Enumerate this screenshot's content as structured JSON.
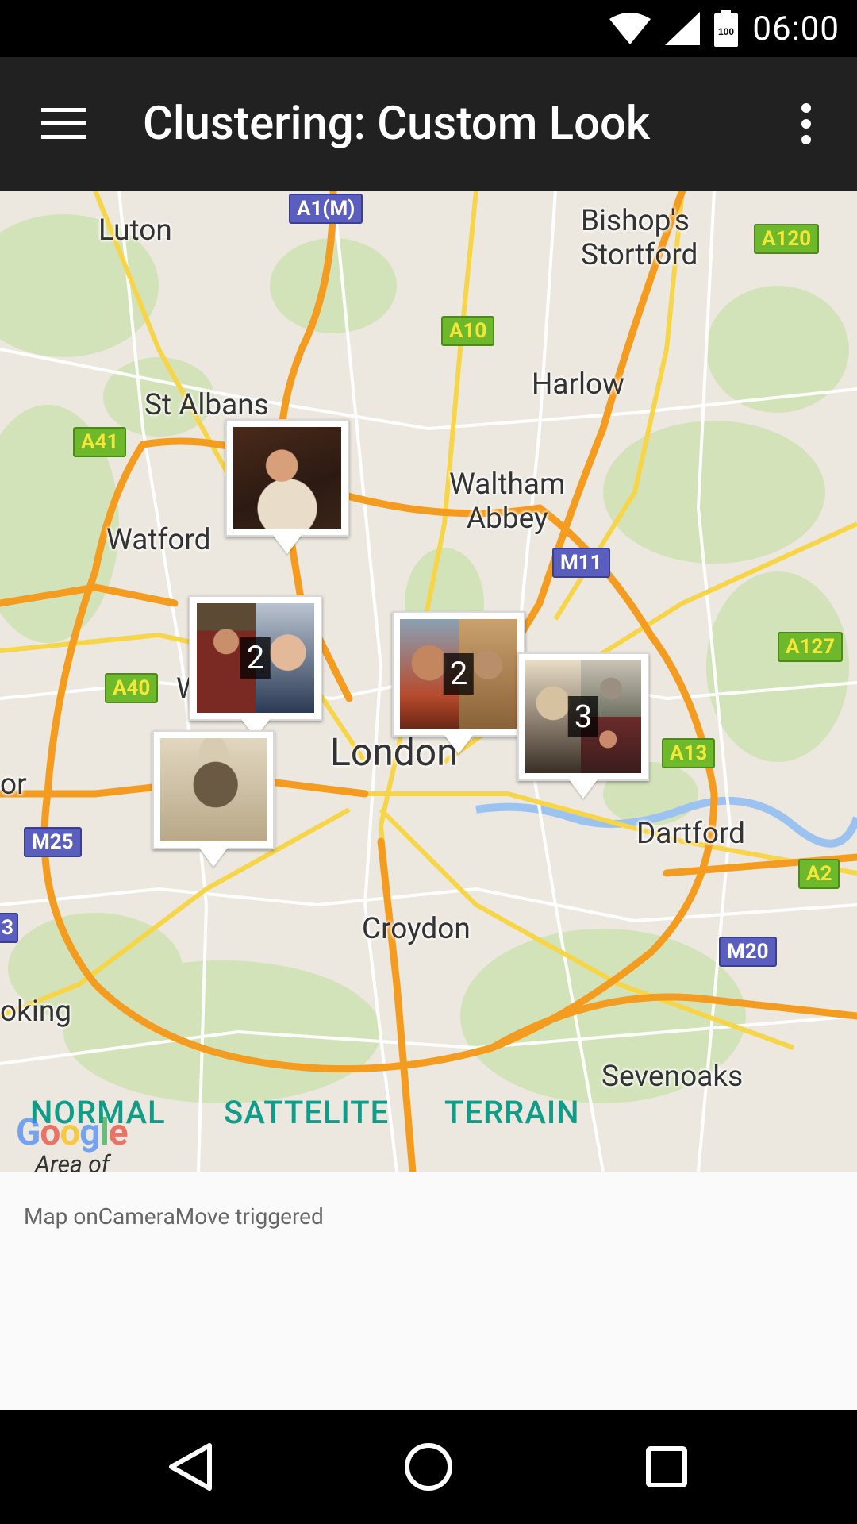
{
  "status_bar": {
    "time": "06:00",
    "battery_level": "100",
    "icons": [
      "wifi-icon",
      "cell-signal-icon",
      "battery-icon"
    ]
  },
  "app_bar": {
    "title": "Clustering: Custom Look",
    "icons": [
      "menu-icon",
      "more-vert-icon"
    ]
  },
  "map": {
    "places": {
      "luton": "Luton",
      "bishops_stortford": "Bishop's\nStortford",
      "harlow": "Harlow",
      "st_albans": "St Albans",
      "waltham_abbey": "Waltham\nAbbey",
      "watford": "Watford",
      "london": "London",
      "dartford": "Dartford",
      "croydon": "Croydon",
      "sevenoaks": "Sevenoaks",
      "woking": "oking",
      "w_partial": "W",
      "or_partial": "or"
    },
    "road_shields": {
      "a1m": "A1(M)",
      "a120": "A120",
      "a10": "A10",
      "a41": "A41",
      "m11": "M11",
      "a127": "A127",
      "a40": "A40",
      "a13": "A13",
      "m25": "M25",
      "a2": "A2",
      "m20": "M20",
      "edge_3": "3"
    },
    "clusters": {
      "c2a": "2",
      "c2b": "2",
      "c3": "3"
    },
    "map_types": {
      "normal": "NORMAL",
      "satellite": "SATTELITE",
      "terrain": "TERRAIN"
    },
    "logo": "Google",
    "area_label": "Area of"
  },
  "log": {
    "message": "Map onCameraMove triggered"
  },
  "colors": {
    "accent": "#0f9d8a",
    "app_bar": "#212121",
    "motorway": "#f39c1f"
  }
}
